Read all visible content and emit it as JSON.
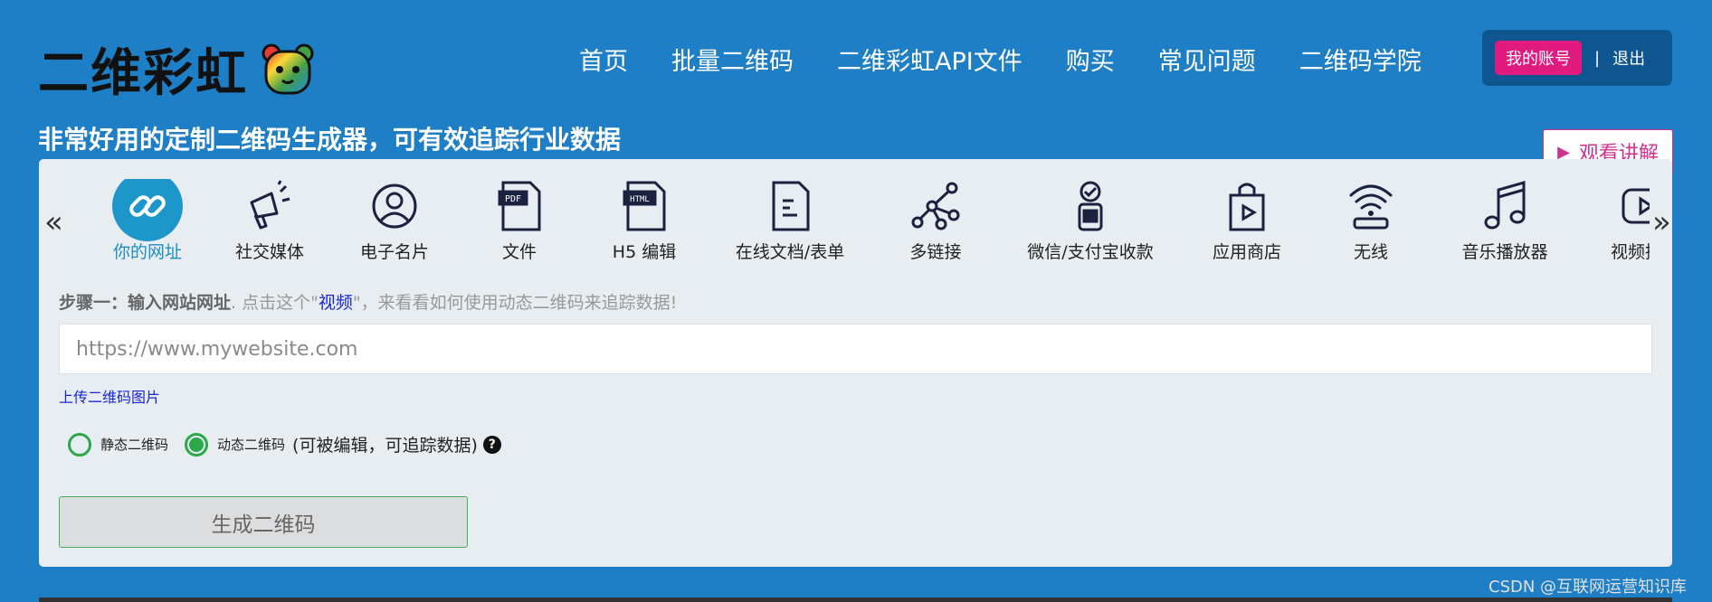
{
  "header": {
    "logo_text": "二维彩虹",
    "nav": [
      "首页",
      "批量二维码",
      "二维彩虹API文件",
      "购买",
      "常见问题",
      "二维码学院"
    ],
    "account_label": "我的账号",
    "separator": "|",
    "logout_label": "退出"
  },
  "tagline": "非常好用的定制二维码生成器，可有效追踪行业数据",
  "watch_button": {
    "icon": "play-icon",
    "label": "观看讲解"
  },
  "categories": [
    {
      "label": "你的网址",
      "icon": "link-icon",
      "active": true
    },
    {
      "label": "社交媒体",
      "icon": "megaphone-icon"
    },
    {
      "label": "电子名片",
      "icon": "user-icon"
    },
    {
      "label": "文件",
      "icon": "pdf-icon"
    },
    {
      "label": "H5 编辑",
      "icon": "html-icon"
    },
    {
      "label": "在线文档/表单",
      "icon": "document-icon"
    },
    {
      "label": "多链接",
      "icon": "multilink-icon"
    },
    {
      "label": "微信/支付宝收款",
      "icon": "payment-icon"
    },
    {
      "label": "应用商店",
      "icon": "shopping-bag-icon"
    },
    {
      "label": "无线",
      "icon": "wifi-icon"
    },
    {
      "label": "音乐播放器",
      "icon": "music-icon"
    },
    {
      "label": "视频播放",
      "icon": "video-icon"
    }
  ],
  "step": {
    "bold": "步骤一：输入网站网址",
    "text_a": ". 点击这个\"",
    "link": "视频",
    "text_b": "\"，来看看如何使用动态二维码来追踪数据!"
  },
  "url_input": {
    "placeholder": "https://www.mywebsite.com",
    "value": ""
  },
  "upload_link": "上传二维码图片",
  "radio": {
    "static_label": "静态二维码",
    "dynamic_label": "动态二维码",
    "dynamic_note": "(可被编辑，可追踪数据)",
    "selected": "dynamic",
    "help": "?"
  },
  "generate_button": "生成二维码",
  "watermark": "CSDN @互联网运营知识库",
  "colors": {
    "background": "#1e7fc6",
    "accent": "#1d96c9",
    "pink": "#e01a7e",
    "green": "#2aa84a"
  }
}
